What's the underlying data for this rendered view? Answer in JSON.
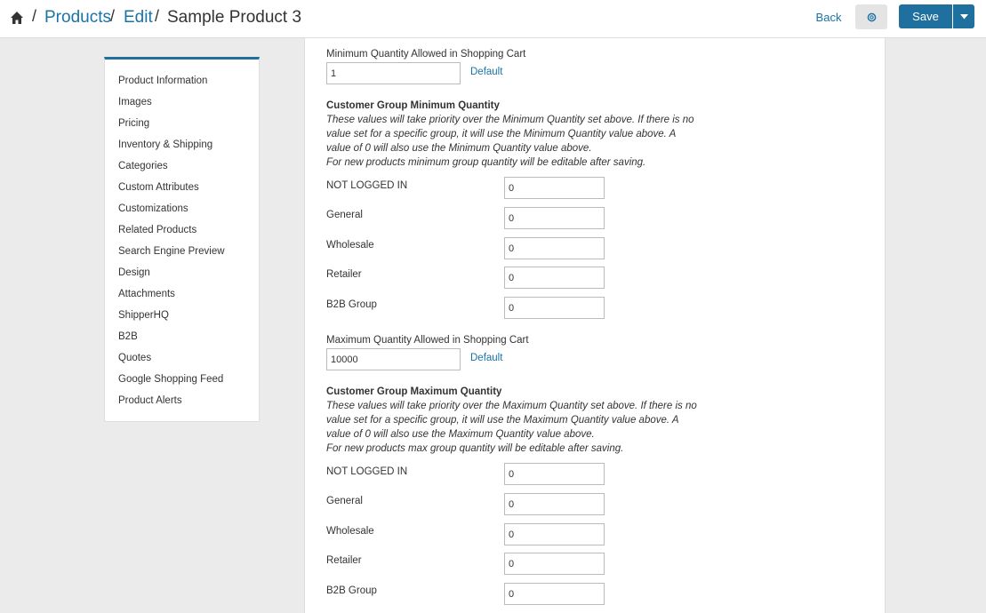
{
  "breadcrumb": {
    "products": "Products",
    "edit": "Edit",
    "current": "Sample Product 3",
    "separator": "/"
  },
  "header": {
    "back_label": "Back",
    "save_label": "Save"
  },
  "sidebar": {
    "items": [
      "Product Information",
      "Images",
      "Pricing",
      "Inventory & Shipping",
      "Categories",
      "Custom Attributes",
      "Customizations",
      "Related Products",
      "Search Engine Preview",
      "Design",
      "Attachments",
      "ShipperHQ",
      "B2B",
      "Quotes",
      "Google Shopping Feed",
      "Product Alerts"
    ]
  },
  "form": {
    "min_qty": {
      "label": "Minimum Quantity Allowed in Shopping Cart",
      "value": "1",
      "default_label": "Default"
    },
    "min_group": {
      "title": "Customer Group Minimum Quantity",
      "desc": [
        "These values will take priority over the Minimum Quantity set above. If there is no",
        "value set for a specific group, it will use the Minimum Quantity value above. A",
        "value of 0 will also use the Minimum Quantity value above.",
        "For new products minimum group quantity will be editable after saving."
      ],
      "rows": [
        {
          "label": "NOT LOGGED IN",
          "value": "0"
        },
        {
          "label": "General",
          "value": "0"
        },
        {
          "label": "Wholesale",
          "value": "0"
        },
        {
          "label": "Retailer",
          "value": "0"
        },
        {
          "label": "B2B Group",
          "value": "0"
        }
      ]
    },
    "max_qty": {
      "label": "Maximum Quantity Allowed in Shopping Cart",
      "value": "10000",
      "default_label": "Default"
    },
    "max_group": {
      "title": "Customer Group Maximum Quantity",
      "desc": [
        "These values will take priority over the Maximum Quantity set above. If there is no",
        "value set for a specific group, it will use the Maximum Quantity value above. A",
        "value of 0 will also use the Maximum Quantity value above.",
        "For new products max group quantity will be editable after saving."
      ],
      "rows": [
        {
          "label": "NOT LOGGED IN",
          "value": "0"
        },
        {
          "label": "General",
          "value": "0"
        },
        {
          "label": "Wholesale",
          "value": "0"
        },
        {
          "label": "Retailer",
          "value": "0"
        },
        {
          "label": "B2B Group",
          "value": "0"
        }
      ]
    }
  },
  "colors": {
    "accent": "#1f6f9f",
    "link": "#1a73a8",
    "background": "#ebebeb"
  }
}
